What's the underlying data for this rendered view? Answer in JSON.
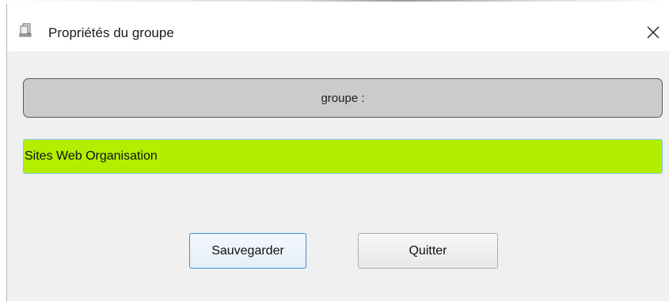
{
  "window": {
    "title": "Propriétés du groupe",
    "icon": "app-window-icon",
    "close_icon": "close-icon"
  },
  "form": {
    "group_label": "groupe :",
    "group_value": "Sites Web Organisation",
    "input_background": "#b3ee00"
  },
  "buttons": {
    "save_label": "Sauvegarder",
    "quit_label": "Quitter"
  }
}
